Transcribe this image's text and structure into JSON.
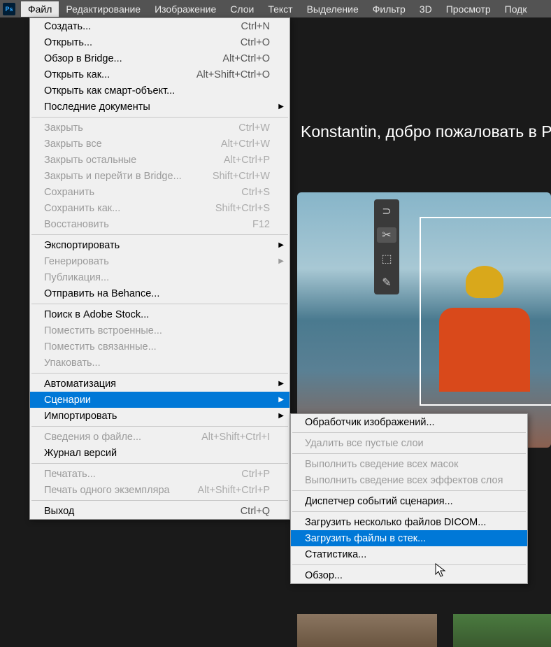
{
  "app_icon": "Ps",
  "menubar": [
    "Файл",
    "Редактирование",
    "Изображение",
    "Слои",
    "Текст",
    "Выделение",
    "Фильтр",
    "3D",
    "Просмотр",
    "Подк"
  ],
  "welcome": "Konstantin, добро пожаловать в Ph",
  "file_menu": {
    "g1": [
      {
        "label": "Создать...",
        "sc": "Ctrl+N"
      },
      {
        "label": "Открыть...",
        "sc": "Ctrl+O"
      },
      {
        "label": "Обзор в Bridge...",
        "sc": "Alt+Ctrl+O"
      },
      {
        "label": "Открыть как...",
        "sc": "Alt+Shift+Ctrl+O"
      },
      {
        "label": "Открыть как смарт-объект...",
        "sc": ""
      },
      {
        "label": "Последние документы",
        "sc": "",
        "arrow": true
      }
    ],
    "g2": [
      {
        "label": "Закрыть",
        "sc": "Ctrl+W",
        "dis": true
      },
      {
        "label": "Закрыть все",
        "sc": "Alt+Ctrl+W",
        "dis": true
      },
      {
        "label": "Закрыть остальные",
        "sc": "Alt+Ctrl+P",
        "dis": true
      },
      {
        "label": "Закрыть и перейти в Bridge...",
        "sc": "Shift+Ctrl+W",
        "dis": true
      },
      {
        "label": "Сохранить",
        "sc": "Ctrl+S",
        "dis": true
      },
      {
        "label": "Сохранить как...",
        "sc": "Shift+Ctrl+S",
        "dis": true
      },
      {
        "label": "Восстановить",
        "sc": "F12",
        "dis": true
      }
    ],
    "g3": [
      {
        "label": "Экспортировать",
        "sc": "",
        "arrow": true
      },
      {
        "label": "Генерировать",
        "sc": "",
        "arrow": true,
        "dis": true
      },
      {
        "label": "Публикация...",
        "sc": "",
        "dis": true
      },
      {
        "label": "Отправить на Behance...",
        "sc": ""
      }
    ],
    "g4": [
      {
        "label": "Поиск в Adobe Stock...",
        "sc": ""
      },
      {
        "label": "Поместить встроенные...",
        "sc": "",
        "dis": true
      },
      {
        "label": "Поместить связанные...",
        "sc": "",
        "dis": true
      },
      {
        "label": "Упаковать...",
        "sc": "",
        "dis": true
      }
    ],
    "g5": [
      {
        "label": "Автоматизация",
        "sc": "",
        "arrow": true
      },
      {
        "label": "Сценарии",
        "sc": "",
        "arrow": true,
        "hl": true
      },
      {
        "label": "Импортировать",
        "sc": "",
        "arrow": true
      }
    ],
    "g6": [
      {
        "label": "Сведения о файле...",
        "sc": "Alt+Shift+Ctrl+I",
        "dis": true
      },
      {
        "label": "Журнал версий",
        "sc": ""
      }
    ],
    "g7": [
      {
        "label": "Печатать...",
        "sc": "Ctrl+P",
        "dis": true
      },
      {
        "label": "Печать одного экземпляра",
        "sc": "Alt+Shift+Ctrl+P",
        "dis": true
      }
    ],
    "g8": [
      {
        "label": "Выход",
        "sc": "Ctrl+Q"
      }
    ]
  },
  "submenu": {
    "g1": [
      {
        "label": "Обработчик изображений...",
        "sc": ""
      }
    ],
    "g2": [
      {
        "label": "Удалить все пустые слои",
        "sc": "",
        "dis": true
      }
    ],
    "g3": [
      {
        "label": "Выполнить сведение всех масок",
        "sc": "",
        "dis": true
      },
      {
        "label": "Выполнить сведение всех эффектов слоя",
        "sc": "",
        "dis": true
      }
    ],
    "g4": [
      {
        "label": "Диспетчер событий сценария...",
        "sc": ""
      }
    ],
    "g5": [
      {
        "label": "Загрузить несколько файлов DICOM...",
        "sc": ""
      },
      {
        "label": "Загрузить файлы в стек...",
        "sc": "",
        "hl": true
      },
      {
        "label": "Статистика...",
        "sc": ""
      }
    ],
    "g6": [
      {
        "label": "Обзор...",
        "sc": ""
      }
    ]
  },
  "tools": [
    "lasso",
    "crop",
    "object",
    "eyedrop"
  ]
}
